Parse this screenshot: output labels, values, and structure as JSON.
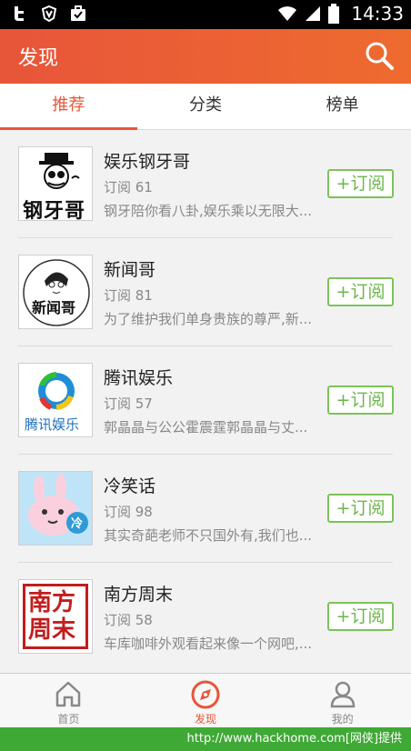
{
  "status_bar": {
    "time": "14:33"
  },
  "app_bar": {
    "title": "发现"
  },
  "tabs": [
    {
      "label": "推荐",
      "active": true
    },
    {
      "label": "分类",
      "active": false
    },
    {
      "label": "榜单",
      "active": false
    }
  ],
  "items": [
    {
      "name": "娱乐钢牙哥",
      "subs": "订阅 61",
      "desc": "钢牙陪你看八卦,娱乐乘以无限大...",
      "button": "+订阅",
      "thumb_text": "钢牙哥"
    },
    {
      "name": "新闻哥",
      "subs": "订阅 81",
      "desc": "为了维护我们单身贵族的尊严,新...",
      "button": "+订阅",
      "thumb_text": "新闻哥"
    },
    {
      "name": "腾讯娱乐",
      "subs": "订阅 57",
      "desc": "郭晶晶与公公霍震霆郭晶晶与丈...",
      "button": "+订阅",
      "thumb_text": "腾讯娱乐"
    },
    {
      "name": "冷笑话",
      "subs": "订阅 98",
      "desc": "其实奇葩老师不只国外有,我们也...",
      "button": "+订阅",
      "thumb_text": "冷"
    },
    {
      "name": "南方周末",
      "subs": "订阅 58",
      "desc": "车库咖啡外观看起来像一个网吧,...",
      "button": "+订阅",
      "thumb_text": "南方周末"
    }
  ],
  "bottom_nav": [
    {
      "label": "首页",
      "icon": "home-icon",
      "active": false
    },
    {
      "label": "发现",
      "icon": "compass-icon",
      "active": true
    },
    {
      "label": "我的",
      "icon": "person-icon",
      "active": false
    }
  ],
  "footer": {
    "text": "http://www.hackhome.com[网侠]提供"
  },
  "colors": {
    "accent": "#e8553a",
    "subscribe_green": "#6db64b",
    "footer_green": "#3fa935"
  }
}
